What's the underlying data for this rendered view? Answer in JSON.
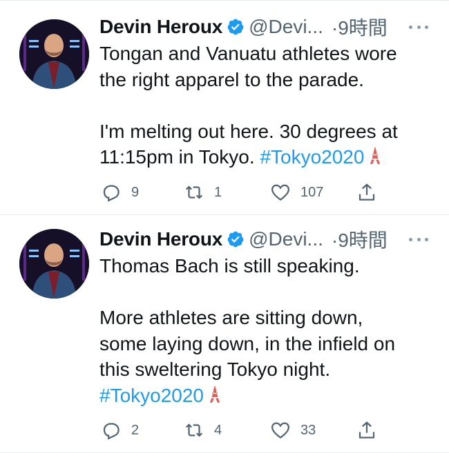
{
  "tweets": [
    {
      "author_name": "Devin Heroux",
      "handle": "@Devi...",
      "time": "·9時間",
      "text_lines": [
        "Tongan and Vanuatu athletes wore",
        "the right apparel to the parade."
      ],
      "text_lines_2": [
        "I'm melting out here. 30 degrees at"
      ],
      "last_line_prefix": "11:15pm in Tokyo.",
      "hashtag": "#Tokyo2020",
      "replies": "9",
      "retweets": "1",
      "likes": "107"
    },
    {
      "author_name": "Devin Heroux",
      "handle": "@Devi...",
      "time": "·9時間",
      "text_lines": [
        "Thomas Bach is still speaking."
      ],
      "text_lines_2": [
        "More athletes are sitting down,",
        "some laying down, in the infield on",
        "this sweltering Tokyo night."
      ],
      "hashtag": "#Tokyo2020",
      "replies": "2",
      "retweets": "4",
      "likes": "33"
    }
  ],
  "icons": {
    "verified": "verified-badge-icon",
    "more": "more-dots-icon",
    "reply": "reply-icon",
    "retweet": "retweet-icon",
    "like": "heart-icon",
    "share": "share-icon",
    "emoji": "tokyo-tower-emoji"
  },
  "colors": {
    "link": "#1d9bf0",
    "secondary": "#536471",
    "text": "#0f1419"
  }
}
